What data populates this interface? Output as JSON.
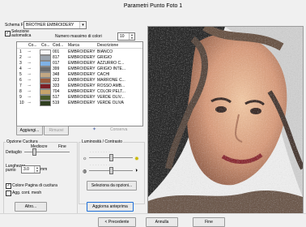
{
  "window": {
    "title": "Parametri Punto Foto 1"
  },
  "left": {
    "thread_chart_label": "Schema Fili",
    "thread_chart_value": "BROTHER EMBROIDERY",
    "auto_select_label": "Selezione automatica",
    "max_colors_label": "Numero massimo di colori",
    "max_colors_value": "10",
    "table": {
      "headers": [
        "Co...",
        "Co...",
        "Cod...",
        "Marca",
        "Descrizione"
      ],
      "rows": [
        {
          "n": "1",
          "code": "001",
          "brand": "EMBROIDERY",
          "desc": "BIANCO",
          "color": "#f7f7f7"
        },
        {
          "n": "2",
          "code": "817",
          "brand": "EMBROIDERY",
          "desc": "GRIGIO",
          "color": "#9aa3ad"
        },
        {
          "n": "3",
          "code": "017",
          "brand": "EMBROIDERY",
          "desc": "AZZURRO C...",
          "color": "#7fb2e6"
        },
        {
          "n": "4",
          "code": "399",
          "brand": "EMBROIDERY",
          "desc": "GRIGIO INTE...",
          "color": "#6c6c6c"
        },
        {
          "n": "5",
          "code": "348",
          "brand": "EMBROIDERY",
          "desc": "CACHI",
          "color": "#c2a783"
        },
        {
          "n": "6",
          "code": "323",
          "brand": "EMBROIDERY",
          "desc": "MARRONE C...",
          "color": "#9a5a3c"
        },
        {
          "n": "7",
          "code": "333",
          "brand": "EMBROIDERY",
          "desc": "ROSSO AMB...",
          "color": "#7c1d25"
        },
        {
          "n": "8",
          "code": "704",
          "brand": "EMBROIDERY",
          "desc": "COLOR PELT...",
          "color": "#c7a36a"
        },
        {
          "n": "9",
          "code": "517",
          "brand": "EMBROIDERY",
          "desc": "VERDE OLIV...",
          "color": "#4a5a2a"
        },
        {
          "n": "10",
          "code": "519",
          "brand": "EMBROIDERY",
          "desc": "VERDE OLIVA",
          "color": "#2f3e1f"
        }
      ]
    },
    "buttons": {
      "add": "Aggiungi...",
      "remove": "Rimuovi",
      "keep": "Conserva"
    },
    "stitch_options": {
      "title": "Opzione Cucitura",
      "detail_label": "Dettaglio",
      "detail_left": "Mediocre",
      "detail_right": "Fine",
      "detail_value": 0.2,
      "length_label": "Lunghezza punto",
      "length_value": "3.0",
      "length_unit": "mm",
      "page_color_label": "Colore Pagina di cucitura",
      "add_mesh_label": "Agg. cont. mesh",
      "other_button": "Altro..."
    },
    "brightness": {
      "title": "Luminosità / Contrasto",
      "brightness_value": 0.5,
      "contrast_value": 0.5,
      "select_options_button": "Seleziona da opzioni..."
    },
    "update_preview_button": "Aggiorna anteprima"
  },
  "footer": {
    "prev": "< Precedente",
    "cancel": "Annulla",
    "finish": "Fine"
  },
  "colors": {
    "accent": "#1e6fd9",
    "title_bar": "#f0f0f0"
  }
}
